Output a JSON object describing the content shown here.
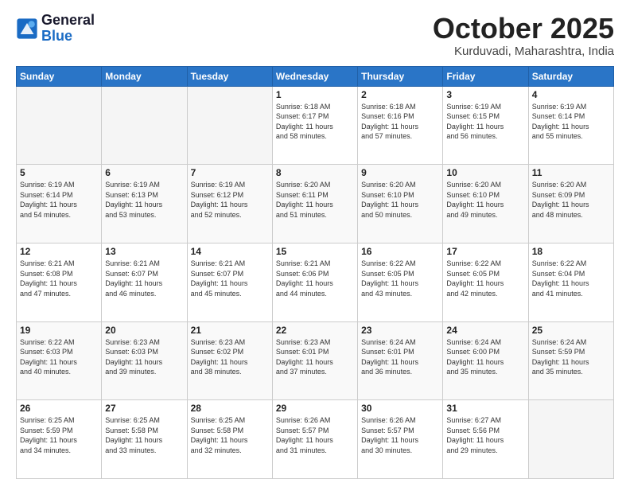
{
  "header": {
    "logo_line1": "General",
    "logo_line2": "Blue",
    "month": "October 2025",
    "location": "Kurduvadi, Maharashtra, India"
  },
  "weekdays": [
    "Sunday",
    "Monday",
    "Tuesday",
    "Wednesday",
    "Thursday",
    "Friday",
    "Saturday"
  ],
  "weeks": [
    [
      {
        "day": "",
        "info": ""
      },
      {
        "day": "",
        "info": ""
      },
      {
        "day": "",
        "info": ""
      },
      {
        "day": "1",
        "info": "Sunrise: 6:18 AM\nSunset: 6:17 PM\nDaylight: 11 hours\nand 58 minutes."
      },
      {
        "day": "2",
        "info": "Sunrise: 6:18 AM\nSunset: 6:16 PM\nDaylight: 11 hours\nand 57 minutes."
      },
      {
        "day": "3",
        "info": "Sunrise: 6:19 AM\nSunset: 6:15 PM\nDaylight: 11 hours\nand 56 minutes."
      },
      {
        "day": "4",
        "info": "Sunrise: 6:19 AM\nSunset: 6:14 PM\nDaylight: 11 hours\nand 55 minutes."
      }
    ],
    [
      {
        "day": "5",
        "info": "Sunrise: 6:19 AM\nSunset: 6:14 PM\nDaylight: 11 hours\nand 54 minutes."
      },
      {
        "day": "6",
        "info": "Sunrise: 6:19 AM\nSunset: 6:13 PM\nDaylight: 11 hours\nand 53 minutes."
      },
      {
        "day": "7",
        "info": "Sunrise: 6:19 AM\nSunset: 6:12 PM\nDaylight: 11 hours\nand 52 minutes."
      },
      {
        "day": "8",
        "info": "Sunrise: 6:20 AM\nSunset: 6:11 PM\nDaylight: 11 hours\nand 51 minutes."
      },
      {
        "day": "9",
        "info": "Sunrise: 6:20 AM\nSunset: 6:10 PM\nDaylight: 11 hours\nand 50 minutes."
      },
      {
        "day": "10",
        "info": "Sunrise: 6:20 AM\nSunset: 6:10 PM\nDaylight: 11 hours\nand 49 minutes."
      },
      {
        "day": "11",
        "info": "Sunrise: 6:20 AM\nSunset: 6:09 PM\nDaylight: 11 hours\nand 48 minutes."
      }
    ],
    [
      {
        "day": "12",
        "info": "Sunrise: 6:21 AM\nSunset: 6:08 PM\nDaylight: 11 hours\nand 47 minutes."
      },
      {
        "day": "13",
        "info": "Sunrise: 6:21 AM\nSunset: 6:07 PM\nDaylight: 11 hours\nand 46 minutes."
      },
      {
        "day": "14",
        "info": "Sunrise: 6:21 AM\nSunset: 6:07 PM\nDaylight: 11 hours\nand 45 minutes."
      },
      {
        "day": "15",
        "info": "Sunrise: 6:21 AM\nSunset: 6:06 PM\nDaylight: 11 hours\nand 44 minutes."
      },
      {
        "day": "16",
        "info": "Sunrise: 6:22 AM\nSunset: 6:05 PM\nDaylight: 11 hours\nand 43 minutes."
      },
      {
        "day": "17",
        "info": "Sunrise: 6:22 AM\nSunset: 6:05 PM\nDaylight: 11 hours\nand 42 minutes."
      },
      {
        "day": "18",
        "info": "Sunrise: 6:22 AM\nSunset: 6:04 PM\nDaylight: 11 hours\nand 41 minutes."
      }
    ],
    [
      {
        "day": "19",
        "info": "Sunrise: 6:22 AM\nSunset: 6:03 PM\nDaylight: 11 hours\nand 40 minutes."
      },
      {
        "day": "20",
        "info": "Sunrise: 6:23 AM\nSunset: 6:03 PM\nDaylight: 11 hours\nand 39 minutes."
      },
      {
        "day": "21",
        "info": "Sunrise: 6:23 AM\nSunset: 6:02 PM\nDaylight: 11 hours\nand 38 minutes."
      },
      {
        "day": "22",
        "info": "Sunrise: 6:23 AM\nSunset: 6:01 PM\nDaylight: 11 hours\nand 37 minutes."
      },
      {
        "day": "23",
        "info": "Sunrise: 6:24 AM\nSunset: 6:01 PM\nDaylight: 11 hours\nand 36 minutes."
      },
      {
        "day": "24",
        "info": "Sunrise: 6:24 AM\nSunset: 6:00 PM\nDaylight: 11 hours\nand 35 minutes."
      },
      {
        "day": "25",
        "info": "Sunrise: 6:24 AM\nSunset: 5:59 PM\nDaylight: 11 hours\nand 35 minutes."
      }
    ],
    [
      {
        "day": "26",
        "info": "Sunrise: 6:25 AM\nSunset: 5:59 PM\nDaylight: 11 hours\nand 34 minutes."
      },
      {
        "day": "27",
        "info": "Sunrise: 6:25 AM\nSunset: 5:58 PM\nDaylight: 11 hours\nand 33 minutes."
      },
      {
        "day": "28",
        "info": "Sunrise: 6:25 AM\nSunset: 5:58 PM\nDaylight: 11 hours\nand 32 minutes."
      },
      {
        "day": "29",
        "info": "Sunrise: 6:26 AM\nSunset: 5:57 PM\nDaylight: 11 hours\nand 31 minutes."
      },
      {
        "day": "30",
        "info": "Sunrise: 6:26 AM\nSunset: 5:57 PM\nDaylight: 11 hours\nand 30 minutes."
      },
      {
        "day": "31",
        "info": "Sunrise: 6:27 AM\nSunset: 5:56 PM\nDaylight: 11 hours\nand 29 minutes."
      },
      {
        "day": "",
        "info": ""
      }
    ]
  ]
}
